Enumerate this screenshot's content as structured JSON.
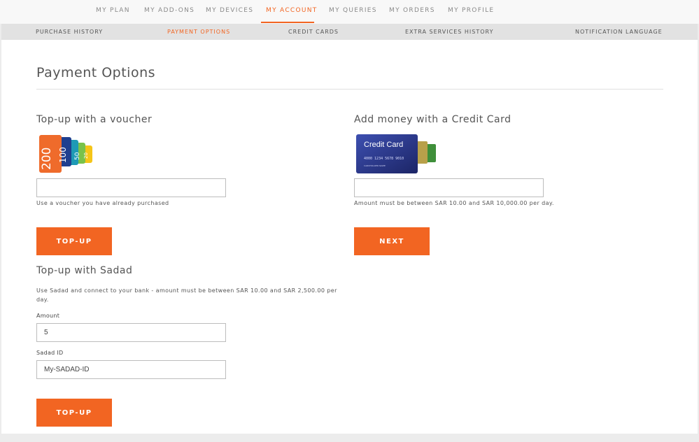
{
  "top_nav": [
    "MY PLAN",
    "MY ADD-ONS",
    "MY DEVICES",
    "MY ACCOUNT",
    "MY QUERIES",
    "MY ORDERS",
    "MY PROFILE"
  ],
  "sub_nav": [
    "PURCHASE HISTORY",
    "PAYMENT OPTIONS",
    "CREDIT CARDS",
    "EXTRA SERVICES HISTORY",
    "NOTIFICATION LANGUAGE"
  ],
  "page_title": "Payment Options",
  "voucher": {
    "title": "Top-up with a voucher",
    "input_value": "",
    "help": "Use a voucher you have already purchased",
    "button": "TOP-UP",
    "card_values": [
      "200",
      "100",
      "50",
      "20"
    ]
  },
  "credit_card": {
    "title": "Add money with a Credit Card",
    "input_value": "",
    "help": "Amount must be between SAR 10.00 and SAR 10,000.00 per day.",
    "button": "NEXT",
    "card_label": "Credit Card",
    "card_number": "4000 1234 5678 9010",
    "card_holder": "CARDHOLDER NAME"
  },
  "sadad": {
    "title": "Top-up with Sadad",
    "help": "Use Sadad and connect to your bank - amount must be between SAR 10.00 and SAR 2,500.00 per day.",
    "amount_label": "Amount",
    "amount_value": "5",
    "id_label": "Sadad ID",
    "id_value": "My-SADAD-ID",
    "button": "TOP-UP"
  },
  "colors": {
    "accent": "#f26522",
    "subnav_bg": "#e2e2e2",
    "page_bg": "#ececec"
  }
}
